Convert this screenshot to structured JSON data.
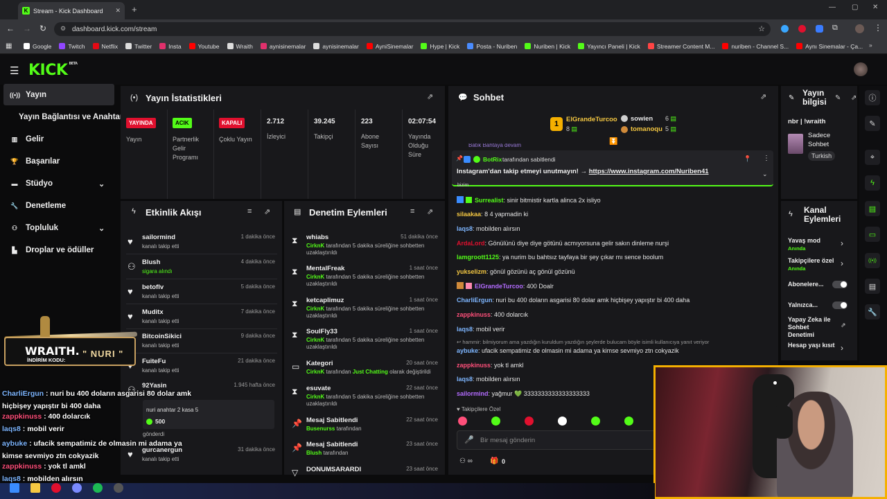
{
  "browser": {
    "tab_title": "Stream - Kick Dashboard",
    "url": "dashboard.kick.com/stream",
    "bookmarks": [
      {
        "label": "Google",
        "color": "#ffffff"
      },
      {
        "label": "Twitch",
        "color": "#9146ff"
      },
      {
        "label": "Netflix",
        "color": "#e50914"
      },
      {
        "label": "Twitter",
        "color": "#dddddd"
      },
      {
        "label": "Insta",
        "color": "#e1306c"
      },
      {
        "label": "Youtube",
        "color": "#ff0000"
      },
      {
        "label": "Wraith",
        "color": "#dddddd"
      },
      {
        "label": "aynisinemalar",
        "color": "#e1306c"
      },
      {
        "label": "aynisinemalar",
        "color": "#dddddd"
      },
      {
        "label": "AyniSinemalar",
        "color": "#ff0000"
      },
      {
        "label": "Hype | Kick",
        "color": "#53fc18"
      },
      {
        "label": "Posta - Nuriben",
        "color": "#4a8cff"
      },
      {
        "label": "Nuriben | Kick",
        "color": "#53fc18"
      },
      {
        "label": "Yayıncı Paneli | Kick",
        "color": "#53fc18"
      },
      {
        "label": "Streamer Content M...",
        "color": "#ff4444"
      },
      {
        "label": "nuriben - Channel S...",
        "color": "#ff0000"
      },
      {
        "label": "Aynı Sinemalar - Ça...",
        "color": "#ff0000"
      }
    ]
  },
  "kick": {
    "logo": "KICK",
    "beta": "BETA"
  },
  "sidebar": {
    "items": [
      {
        "label": "Yayın",
        "icon": "broadcast-icon"
      },
      {
        "label": "Yayın Bağlantısı ve Anahtarı",
        "icon": ""
      },
      {
        "label": "Gelir",
        "icon": "chart-icon"
      },
      {
        "label": "Başarılar",
        "icon": "trophy-icon"
      },
      {
        "label": "Stüdyo",
        "icon": "studio-icon"
      },
      {
        "label": "Denetleme",
        "icon": "wrench-icon"
      },
      {
        "label": "Topluluk",
        "icon": "people-icon"
      },
      {
        "label": "Droplar ve ödüller",
        "icon": "gift-icon"
      }
    ]
  },
  "stats": {
    "title": "Yayın İstatistikleri",
    "badges": [
      {
        "badge": "YAYINDA",
        "label": "Yayın",
        "color": "#e0102e"
      },
      {
        "badge": "ACIK",
        "label": "Partnerlik Gelir Programı",
        "color": "#53fc18"
      },
      {
        "badge": "KAPALI",
        "label": "Çoklu Yayın",
        "color": "#e0102e"
      }
    ],
    "values": [
      {
        "value": "2.712",
        "label": "İzleyici"
      },
      {
        "value": "39.245",
        "label": "Takipçi"
      },
      {
        "value": "223",
        "label": "Abone Sayısı"
      },
      {
        "value": "02:07:54",
        "label": "Yayında Olduğu Süre"
      }
    ]
  },
  "activity": {
    "title": "Etkinlik Akışı",
    "items": [
      {
        "name": "sailormind",
        "sub": "kanalı takip etti",
        "time": "1 dakika önce"
      },
      {
        "name": "Blush",
        "sub": "sigara alındı",
        "time": "4 dakika önce"
      },
      {
        "name": "betoflv",
        "sub": "kanalı takip etti",
        "time": "5 dakika önce"
      },
      {
        "name": "Muditx",
        "sub": "kanalı takip etti",
        "time": "7 dakika önce"
      },
      {
        "name": "BitcoinSikici",
        "sub": "kanalı takip etti",
        "time": "9 dakika önce"
      },
      {
        "name": "FuiteFu",
        "sub": "kanalı takip etti",
        "time": "21 dakika önce"
      },
      {
        "name": "92Yasin",
        "sub": "",
        "time": "1.945 hafta önce"
      },
      {
        "name": "gurcanergun",
        "sub": "kanalı takip etti",
        "time": "31 dakika önce"
      }
    ],
    "gift_box": {
      "text": "nuri anahtar 2 kasa 5",
      "amount": "500",
      "sent": "gönderdi"
    }
  },
  "moderation": {
    "title": "Denetim Eylemleri",
    "items": [
      {
        "name": "whiabs",
        "actor": "CirknK",
        "sub": "tarafından 5 dakika süreliğine sohbetten uzaklaştırıldı",
        "time": "51 dakika önce"
      },
      {
        "name": "MentalFreak",
        "actor": "CirknK",
        "sub": "tarafından 5 dakika süreliğine sohbetten uzaklaştırıldı",
        "time": "1 saat önce"
      },
      {
        "name": "ketcaplimuz",
        "actor": "CirknK",
        "sub": "tarafından 5 dakika süreliğine sohbetten uzaklaştırıldı",
        "time": "1 saat önce"
      },
      {
        "name": "SoulFly33",
        "actor": "CirknK",
        "sub": "tarafından 5 dakika süreliğine sohbetten uzaklaştırıldı",
        "time": "1 saat önce"
      },
      {
        "name": "Kategori",
        "actor": "CirknK",
        "sub": "tarafından",
        "extra": "Just Chatting",
        "extra2": "olarak değiştirildi",
        "time": "20 saat önce"
      },
      {
        "name": "esuvate",
        "actor": "CirknK",
        "sub": "tarafından 5 dakika süreliğine sohbetten uzaklaştırıldı",
        "time": "22 saat önce"
      },
      {
        "name": "Mesaj Sabitlendi",
        "actor": "Busenurss",
        "sub": "tarafından",
        "time": "22 saat önce"
      },
      {
        "name": "Mesaj Sabitlendi",
        "actor": "Blush",
        "sub": "tarafından",
        "time": "23 saat önce"
      },
      {
        "name": "DONUMSARARDI",
        "actor": "",
        "sub": "",
        "time": "23 saat önce"
      }
    ]
  },
  "chat": {
    "title": "Sohbet",
    "top_gifters": [
      {
        "rank": "1",
        "name": "ElGrandeTurcoo",
        "count": "8"
      },
      {
        "name": "sowien",
        "count": "6"
      },
      {
        "name": "tomanoqu",
        "count": "5"
      }
    ],
    "pinned": {
      "by": "BotRix",
      "label": "tarafından sabitlendi",
      "text": "Instagram'dan takip etmeyi unutmayın! →",
      "link": "https://www.instagram.com/Nuriben41"
    },
    "messages": [
      {
        "user": "Surrealist",
        "color": "#53fc18",
        "text": "sinir bitmistir kartla alinca 2x isliyo"
      },
      {
        "user": "silaakaa",
        "color": "#f5c842",
        "text": "8 4 yapmadin ki"
      },
      {
        "user": "laqs8",
        "color": "#7eb6ff",
        "text": "mobilden alırsın"
      },
      {
        "user": "ArdaLord",
        "color": "#e0102e",
        "text": "Gönülünü diye diye götünü acmıyorsuna gelir sakın dinleme nurşi"
      },
      {
        "user": "lamgroott1125",
        "color": "#53fc18",
        "text": "ya nurim bu bahtsız tayfaya bir şey çıkar mı sence boolum"
      },
      {
        "user": "yukselizm",
        "color": "#f5c842",
        "text": "gönül gözünü aç gönül gözünü"
      },
      {
        "user": "ElGrandeTurcoo",
        "color": "#b36cff",
        "text": "400 Doalr"
      },
      {
        "user": "CharliErgun",
        "color": "#7eb6ff",
        "text": "nuri bu 400 doların asgarisi 80 dolar amk hiçbişey yapıştır bi 400 daha"
      },
      {
        "user": "zappkinuss",
        "color": "#ff4f7a",
        "text": "400 dolarcık"
      },
      {
        "user": "laqs8",
        "color": "#7eb6ff",
        "text": "mobil verir"
      },
      {
        "user": "aybuke",
        "color": "#7eb6ff",
        "text": "ufacik sempatimiz de olmasin mi adama ya kimse sevmiyo ztn cokyazik"
      },
      {
        "user": "zappkinuss",
        "color": "#ff4f7a",
        "text": "yok tl amkl"
      },
      {
        "user": "laqs8",
        "color": "#7eb6ff",
        "text": "mobilden alırsın"
      },
      {
        "user": "sailormind",
        "color": "#b36cff",
        "text": "yağmur 💚 3333333333333333333"
      }
    ],
    "reply_note": "hammir: bilmiyorum ama yazdığın kuruldum yazdığın şeylerde bulucam böyle isimli kullanıcıya yanıt veriyor",
    "followers_only": "Takipçilere Özel",
    "input_placeholder": "Bir mesaj gönderin",
    "footer_count": "0",
    "partial_top": "Batık Bahtaya devam",
    "partial_bizim": "bizim"
  },
  "stream_info": {
    "title": "Yayın bilgisi",
    "stream_title": "nbr | !wraith",
    "category": "Sadece Sohbet",
    "language": "Turkish"
  },
  "channel_actions": {
    "title": "Kanal Eylemleri",
    "items": [
      {
        "label": "Yavaş mod",
        "sub": "Anında"
      },
      {
        "label": "Takipçilere özel",
        "sub": "Anında"
      },
      {
        "label": "Abonelere...",
        "sub": ""
      },
      {
        "label": "Yalnızca...",
        "sub": ""
      },
      {
        "label": "Yapay Zeka ile Sohbet Denetimi",
        "sub": ""
      },
      {
        "label": "Hesap yaşı kısıt",
        "sub": ""
      }
    ]
  },
  "overlay": {
    "brand": "WRAITH.",
    "code_label": "İNDİRİM KODU:",
    "code": "NURI",
    "chat": [
      {
        "user": "CharliErgun",
        "color": "#7eb6ff",
        "text": ": nuri bu 400 doların asgarisi 80 dolar amk hiçbişey yapıştır bi 400 daha"
      },
      {
        "user": "zappkinuss",
        "color": "#ff4f7a",
        "text": ": 400 dolarcık"
      },
      {
        "user": "laqs8",
        "color": "#7eb6ff",
        "text": ": mobil verir"
      },
      {
        "user": "aybuke",
        "color": "#7eb6ff",
        "text": ": ufacik sempatimiz de olmasin mi adama ya kimse sevmiyo ztn cokyazik"
      },
      {
        "user": "zappkinuss",
        "color": "#ff4f7a",
        "text": ": yok tl amkl"
      },
      {
        "user": "laqs8",
        "color": "#7eb6ff",
        "text": ": mobilden alırsın"
      },
      {
        "user": "sailormind",
        "color": "#b36cff",
        "text": ": yağmur 💚 3333333333333333333"
      }
    ]
  }
}
